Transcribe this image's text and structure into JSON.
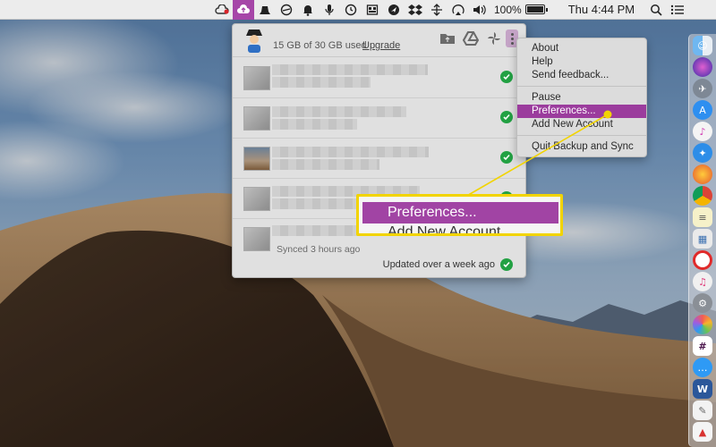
{
  "menubar": {
    "status_icons": [
      "creative-cloud-icon",
      "backup-and-sync-icon",
      "alfred-hat-icon",
      "do-not-disturb-icon",
      "notifications-icon",
      "siri-icon",
      "time-machine-icon",
      "clipboard-icon",
      "location-icon",
      "dropbox-icon",
      "spaces-icon",
      "airplay-icon",
      "volume-icon"
    ],
    "battery_text": "100%",
    "battery_level": 1.0,
    "clock": "Thu 4:44 PM"
  },
  "panel": {
    "storage_text": "15 GB of 30 GB used",
    "upgrade_label": "Upgrade",
    "header_icons": [
      "folder-icon",
      "google-drive-icon",
      "google-photos-icon",
      "more-options-icon"
    ],
    "synced_text": "Synced 3 hours ago",
    "footer_status": "Updated over a week ago"
  },
  "menu": {
    "items": [
      {
        "label": "About"
      },
      {
        "label": "Help"
      },
      {
        "label": "Send feedback..."
      },
      {
        "label": "Pause"
      },
      {
        "label": "Preferences..."
      },
      {
        "label": "Add New Account"
      },
      {
        "label": "Quit Backup and Sync"
      }
    ],
    "selected": "Preferences..."
  },
  "callout": {
    "selected_label": "Preferences...",
    "next_label": "Add New Account"
  },
  "colors": {
    "accent_purple": "#9b3c9d",
    "highlight_yellow": "#f2d400",
    "sync_green": "#22a143"
  },
  "dock": {
    "apps": [
      "finder-icon",
      "siri-icon",
      "launchpad-icon",
      "app-store-icon",
      "itunes-icon",
      "safari-icon",
      "firefox-icon",
      "chrome-icon",
      "notes-icon",
      "preview-icon",
      "no-entry-icon",
      "music-icon",
      "system-preferences-icon",
      "photos-icon",
      "slack-icon",
      "messages-icon",
      "word-icon",
      "textedit-icon",
      "pdf-icon"
    ]
  }
}
